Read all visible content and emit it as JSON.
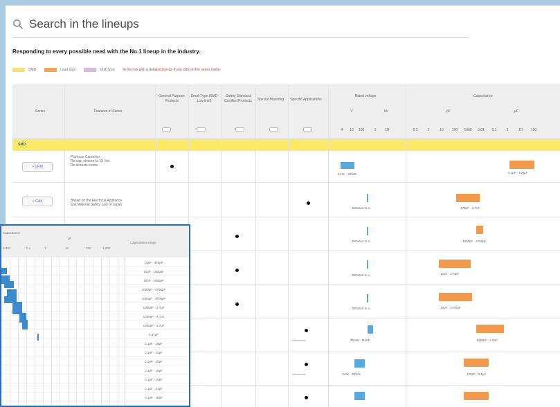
{
  "search": {
    "placeholder": "Search in the lineups"
  },
  "tagline": "Responding to every possible need with the No.1 lineup in the industry.",
  "legend": {
    "items": [
      {
        "label": "SMD",
        "color": "#f6e27a"
      },
      {
        "label": "Lead type",
        "color": "#f4a460"
      },
      {
        "label": "Multi type",
        "color": "#d9b8e0"
      }
    ],
    "note": "In the row with a detailed line-up if you click on the series name."
  },
  "table": {
    "headers": {
      "series": "Series",
      "features": "Features of Series",
      "general": "General Purpose Products",
      "small": "Small Type (SMD Low limit)",
      "safety": "Safety Standard Certified Products",
      "special": "Special Mounting",
      "specific": "Specific Applications",
      "voltage": "Rated voltage",
      "capacitance": "Capacitance",
      "v_left": "V",
      "v_right": "kV",
      "pf_left": "pF",
      "pf_right": "µF"
    },
    "voltage_ticks": [
      "4",
      "10",
      "100",
      "1",
      "10"
    ],
    "cap_ticks": [
      "0.1",
      "1",
      "10",
      "100",
      "1000",
      "0.01",
      "0.1",
      "1",
      "10",
      "100"
    ],
    "group": "SMD",
    "rows": [
      {
        "series": "» GRM",
        "features": [
          "Plurimax Capacitor",
          "Rs cap, chosen to 10 Voc",
          "Rs acoustic noise"
        ],
        "dot_col": "general",
        "vrange": "2Vdc - 50Vdc",
        "crange": "0.1pF - 100µF"
      },
      {
        "series": "» GA3",
        "features": [
          "Based on the Electrical Appliance",
          "and Material Safety Law of Japan"
        ],
        "dot_col": "specific",
        "vrange": "250Vac/r.m.s.",
        "crange": "470pF - 4.7nF"
      },
      {
        "series": "",
        "features": [],
        "dot_col": "safety",
        "vrange": "250Vac/r.m.s.",
        "crange": "1000pF - 4700pF"
      },
      {
        "series": "",
        "features": [],
        "dot_col": "safety",
        "vrange": "250Vac/r.m.s.",
        "crange": "10pF - 470pF"
      },
      {
        "series": "",
        "features": [],
        "dot_col": "safety",
        "vrange": "250Vac/r.m.s.",
        "crange": "10pF - 4700pF"
      },
      {
        "series": "",
        "features": [],
        "dot_col": "specific",
        "unmounted": "Ultrasound",
        "vrange": "25Vdc - 50Vdc",
        "crange": "1000pF - 1.0µF"
      },
      {
        "series": "",
        "features": [],
        "dot_col": "specific",
        "unmounted": "Ultrasound",
        "vrange": "2Vdc - 50Vdc",
        "crange": "100pF - 0.1µF"
      },
      {
        "series": "",
        "features": [],
        "dot_col": "specific",
        "unmounted": "Ultrasound",
        "vrange": "2Vdc - 50Vdc",
        "crange": "1pF - 1µF"
      }
    ]
  },
  "inset": {
    "header_title": "Capacitance",
    "unit": "pF",
    "ticks": [
      "0.001",
      "0.1",
      "1",
      "10",
      "100",
      "1,000"
    ],
    "range_col": "Capacitance range",
    "ranges": [
      "10pF - 470pF",
      "10pF - 1000pF",
      "10pF - 1000pF",
      "1000pF - 4700pF",
      "1000pF - 4700pF",
      "1000pF - 4.7µF",
      "1000pF - 4.7µF",
      "1000pF - 4.7µF",
      "0.47µF",
      "0.1pF - 10pF",
      "0.1pF - 10pF",
      "0.1pF - 10pF",
      "0.1pF - 10pF",
      "0.1pF - 10pF",
      "0.1pF - 22pF",
      "0.1pF - 10pF"
    ]
  }
}
